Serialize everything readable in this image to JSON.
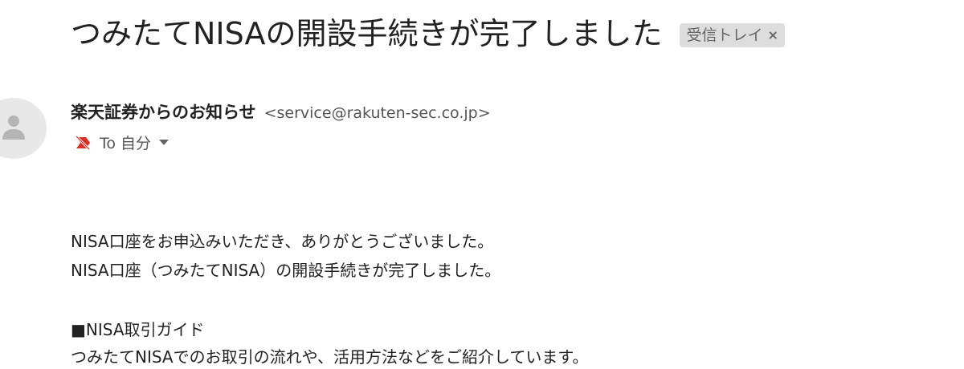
{
  "email": {
    "subject": "つみたてNISAの開設手続きが完了しました",
    "label": {
      "text": "受信トレイ",
      "close": "×"
    },
    "sender": {
      "name": "楽天証券からのお知らせ",
      "email": "<service@rakuten-sec.co.jp>"
    },
    "recipient": {
      "text": "To 自分",
      "icon": "not-important-icon"
    },
    "avatar_icon": "person-icon",
    "body": [
      "NISA口座をお申込みいただき、ありがとうございました。",
      "NISA口座（つみたてNISA）の開設手続きが完了しました。",
      "■NISA取引ガイド",
      "つみたてNISAでのお取引の流れや、活用方法などをご紹介しています。"
    ]
  },
  "colors": {
    "label_bg": "#dddddd",
    "important_icon": "#d93025"
  }
}
